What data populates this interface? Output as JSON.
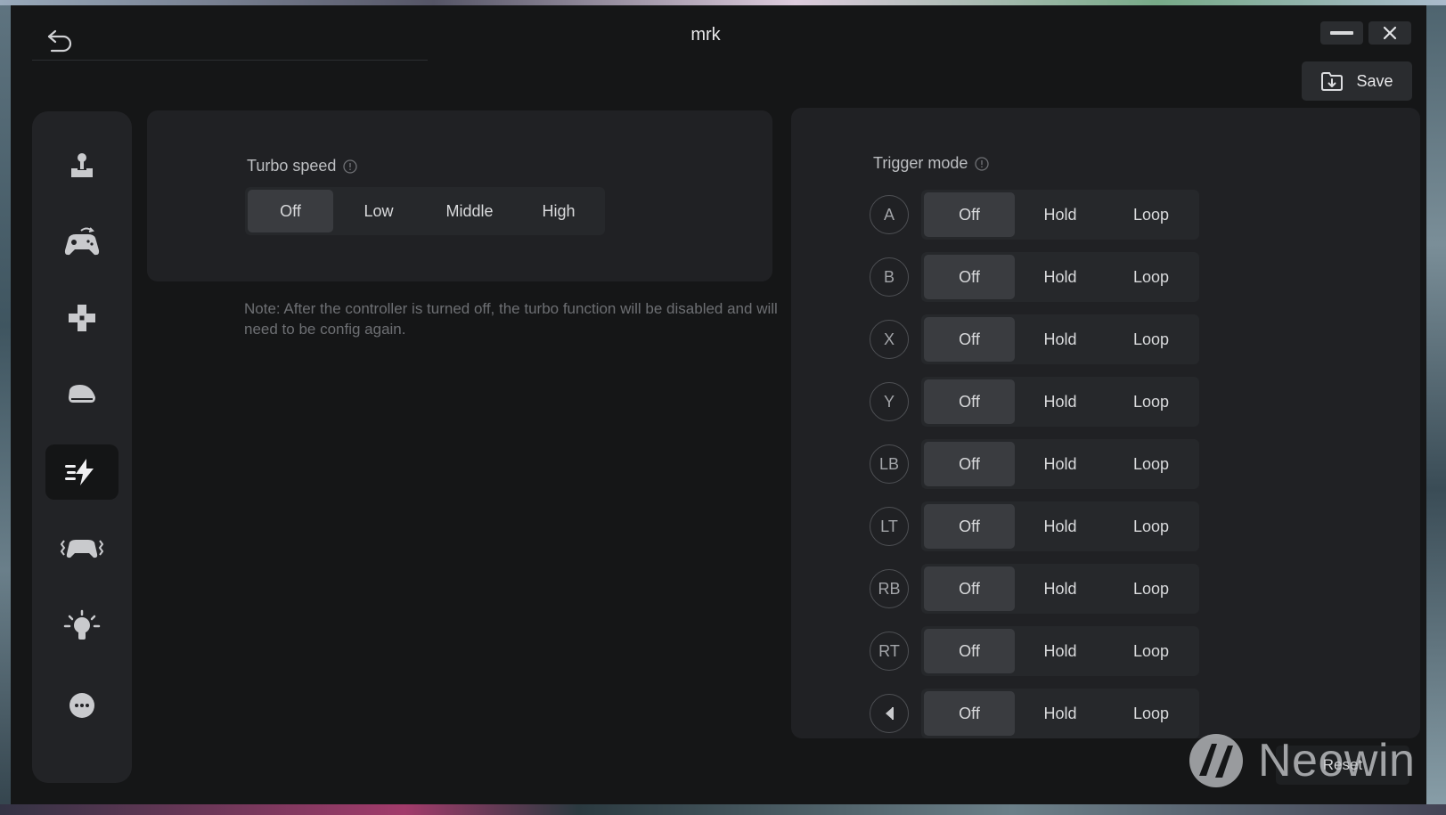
{
  "window": {
    "title": "mrk",
    "back_icon": "undo-arrow-icon",
    "minimize_icon": "minimize-icon",
    "close_icon": "close-icon"
  },
  "toolbar": {
    "save_label": "Save",
    "save_icon": "save-folder-icon",
    "reset_label": "Reset"
  },
  "sidebar": {
    "items": [
      {
        "icon": "joystick-icon",
        "active": false
      },
      {
        "icon": "gamepad-remap-icon",
        "active": false
      },
      {
        "icon": "dpad-icon",
        "active": false
      },
      {
        "icon": "trigger-icon",
        "active": false
      },
      {
        "icon": "turbo-lightning-icon",
        "active": true
      },
      {
        "icon": "vibration-gamepad-icon",
        "active": false
      },
      {
        "icon": "lightbulb-icon",
        "active": false
      },
      {
        "icon": "more-icon",
        "active": false
      }
    ]
  },
  "turbo": {
    "label": "Turbo speed",
    "options": [
      "Off",
      "Low",
      "Middle",
      "High"
    ],
    "selected": "Off",
    "note": "Note: After the controller is turned off, the turbo function will be disabled and will need to be config again."
  },
  "trigger": {
    "label": "Trigger mode",
    "options": [
      "Off",
      "Hold",
      "Loop"
    ],
    "rows": [
      {
        "button": "A",
        "selected": "Off"
      },
      {
        "button": "B",
        "selected": "Off"
      },
      {
        "button": "X",
        "selected": "Off"
      },
      {
        "button": "Y",
        "selected": "Off"
      },
      {
        "button": "LB",
        "selected": "Off"
      },
      {
        "button": "LT",
        "selected": "Off"
      },
      {
        "button": "RB",
        "selected": "Off"
      },
      {
        "button": "RT",
        "selected": "Off"
      },
      {
        "button": "",
        "icon": "dpad-left-icon",
        "selected": "Off"
      }
    ]
  },
  "watermark": {
    "text": "Neowin",
    "icon": "neowin-logo-icon"
  },
  "colors": {
    "app_bg": "#151617",
    "card_bg": "#202124",
    "sidebar_bg": "#222326",
    "selected_option": "#3a3c40",
    "text": "#d7d8da",
    "muted_text": "#6d6f73"
  }
}
